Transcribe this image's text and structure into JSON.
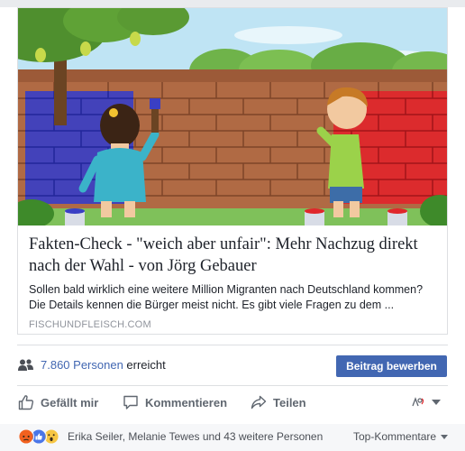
{
  "link_preview": {
    "title": "Fakten-Check - \"weich aber unfair\": Mehr Nachzug direkt nach der Wahl - von Jörg Gebauer",
    "description": "Sollen bald wirklich eine weitere Million Migranten nach Deutschland kommen? Die Details kennen die Bürger meist nicht. Es gibt viele Fragen zu dem ...",
    "domain": "FISCHUNDFLEISCH.COM"
  },
  "reach": {
    "count_label": "7.860 Personen",
    "suffix": "erreicht",
    "boost_label": "Beitrag bewerben"
  },
  "actions": {
    "like": "Gefällt mir",
    "comment": "Kommentieren",
    "share": "Teilen"
  },
  "reactions": {
    "names": "Erika Seiler, Melanie Tewes und 43 weitere Personen",
    "filter_label": "Top-Kommentare",
    "icons": [
      "angry-reaction-icon",
      "like-reaction-icon",
      "wow-reaction-icon"
    ]
  },
  "colors": {
    "link_blue": "#4267b2",
    "muted_gray": "#606770",
    "wall_blue": "#3a3fc4",
    "wall_red": "#e0262b",
    "wall_brown": "#a8633e"
  }
}
